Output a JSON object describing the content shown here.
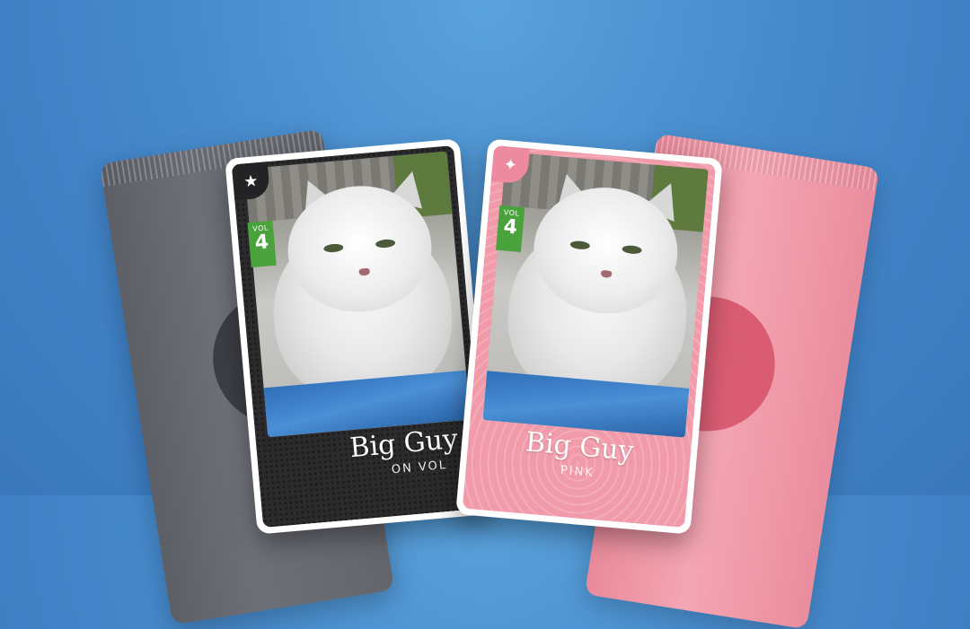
{
  "packs": {
    "left": {
      "color": "#65676e"
    },
    "right": {
      "color": "#f09aaa"
    }
  },
  "cards": [
    {
      "theme": "dark",
      "icon": "star-icon",
      "icon_glyph": "★",
      "vol_label": "VOL",
      "vol_number": "4",
      "title": "Big Guy",
      "subtitle": "ON VOL"
    },
    {
      "theme": "pink",
      "icon": "sparkle-icon",
      "icon_glyph": "✦",
      "vol_label": "VOL",
      "vol_number": "4",
      "title": "Big Guy",
      "subtitle": "PINK"
    }
  ],
  "colors": {
    "background": "#4a8fd0",
    "vol_badge": "#4aa23c",
    "card_dark": "#2b2b2d",
    "card_pink": "#f19aa9"
  }
}
